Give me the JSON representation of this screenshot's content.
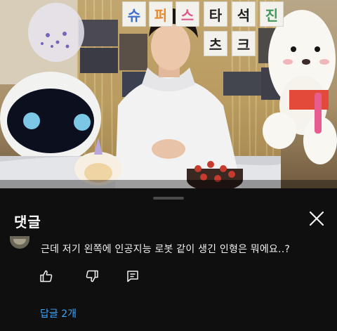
{
  "video": {
    "banner_letters": [
      "슈",
      "퍼",
      "스",
      "타",
      "석",
      "진"
    ],
    "banner_letters_row2": [
      "츠",
      "크"
    ]
  },
  "comments": {
    "title": "댓글",
    "close_icon": "close-icon",
    "items": [
      {
        "text": "근데 저기 왼쪽에 인공지능 로봇 같이 생긴 인형은 뭐에요..?",
        "replies_label": "답글 2개"
      }
    ]
  },
  "colors": {
    "background": "#0f0f0f",
    "text": "#f1f1f1",
    "link": "#3ea6ff"
  }
}
